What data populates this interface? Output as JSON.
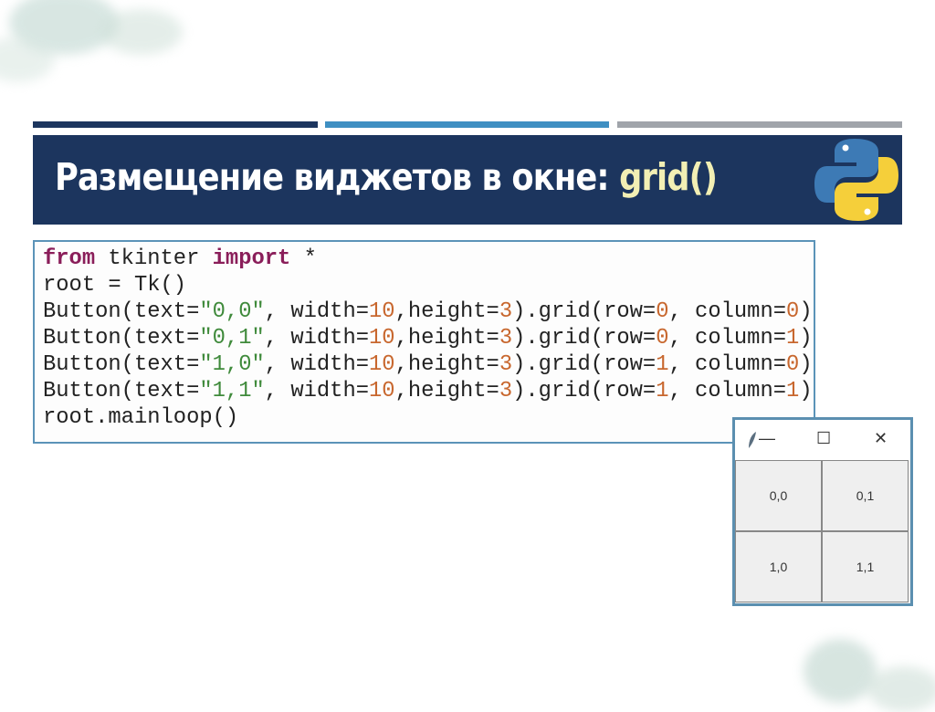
{
  "slide": {
    "title_main": "Размещение виджетов в окне: ",
    "title_highlight": "grid()",
    "logo": "python-logo",
    "colors": {
      "navy": "#1c355e",
      "blue": "#3f8fc2",
      "grey": "#a0a4aa",
      "highlight": "#f2efb4"
    }
  },
  "code": {
    "lines": [
      [
        [
          "kw",
          "from"
        ],
        [
          "plain",
          " tkinter "
        ],
        [
          "kw",
          "import"
        ],
        [
          "plain",
          " *"
        ]
      ],
      [
        [
          "plain",
          "root = Tk()"
        ]
      ],
      [
        [
          "plain",
          "Button(text="
        ],
        [
          "str",
          "\"0,0\""
        ],
        [
          "plain",
          ", width="
        ],
        [
          "num",
          "10"
        ],
        [
          "plain",
          ",height="
        ],
        [
          "num",
          "3"
        ],
        [
          "plain",
          ").grid(row="
        ],
        [
          "num",
          "0"
        ],
        [
          "plain",
          ", column="
        ],
        [
          "num",
          "0"
        ],
        [
          "plain",
          ")"
        ]
      ],
      [
        [
          "plain",
          "Button(text="
        ],
        [
          "str",
          "\"0,1\""
        ],
        [
          "plain",
          ", width="
        ],
        [
          "num",
          "10"
        ],
        [
          "plain",
          ",height="
        ],
        [
          "num",
          "3"
        ],
        [
          "plain",
          ").grid(row="
        ],
        [
          "num",
          "0"
        ],
        [
          "plain",
          ", column="
        ],
        [
          "num",
          "1"
        ],
        [
          "plain",
          ")"
        ]
      ],
      [
        [
          "plain",
          "Button(text="
        ],
        [
          "str",
          "\"1,0\""
        ],
        [
          "plain",
          ", width="
        ],
        [
          "num",
          "10"
        ],
        [
          "plain",
          ",height="
        ],
        [
          "num",
          "3"
        ],
        [
          "plain",
          ").grid(row="
        ],
        [
          "num",
          "1"
        ],
        [
          "plain",
          ", column="
        ],
        [
          "num",
          "0"
        ],
        [
          "plain",
          ")"
        ]
      ],
      [
        [
          "plain",
          "Button(text="
        ],
        [
          "str",
          "\"1,1\""
        ],
        [
          "plain",
          ", width="
        ],
        [
          "num",
          "10"
        ],
        [
          "plain",
          ",height="
        ],
        [
          "num",
          "3"
        ],
        [
          "plain",
          ").grid(row="
        ],
        [
          "num",
          "1"
        ],
        [
          "plain",
          ", column="
        ],
        [
          "num",
          "1"
        ],
        [
          "plain",
          ")"
        ]
      ],
      [
        [
          "plain",
          "root.mainloop()"
        ]
      ]
    ]
  },
  "tk_window": {
    "controls": {
      "minimize": "—",
      "maximize": "☐",
      "close": "✕"
    },
    "buttons": [
      "0,0",
      "0,1",
      "1,0",
      "1,1"
    ]
  }
}
